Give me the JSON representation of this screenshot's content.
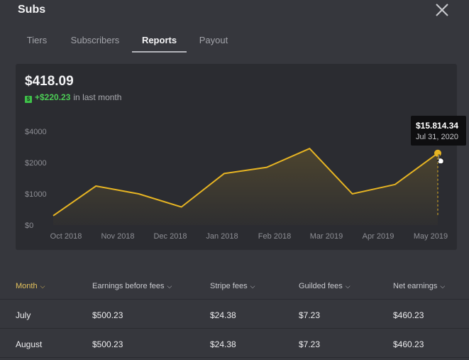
{
  "header": {
    "title": "Subs"
  },
  "tabs": [
    {
      "label": "Tiers"
    },
    {
      "label": "Subscribers"
    },
    {
      "label": "Reports"
    },
    {
      "label": "Payout"
    }
  ],
  "active_tab": "Reports",
  "summary": {
    "total": "$418.09",
    "change": "+$220.23",
    "change_suffix": "in last month"
  },
  "colors": {
    "accent": "#e6b423",
    "positive": "#4ccb55",
    "active_header": "#e4c25d"
  },
  "chart_data": {
    "type": "area",
    "title": "",
    "xlabel": "",
    "ylabel": "",
    "x_ticks": [
      "Oct 2018",
      "Nov 2018",
      "Dec 2018",
      "Jan 2018",
      "Feb 2018",
      "Mar 2019",
      "Apr 2019",
      "May 2019"
    ],
    "y_ticks": [
      "$0",
      "$1000",
      "$2000",
      "$4000"
    ],
    "ylim": [
      0,
      4000
    ],
    "grid": false,
    "series": [
      {
        "values": [
          300,
          1250,
          1000,
          580,
          1650,
          1850,
          2450,
          1000,
          1300,
          2300
        ]
      }
    ],
    "tooltip": {
      "value": "$15.814.34",
      "date": "Jul 31, 2020"
    }
  },
  "table": {
    "columns": [
      "Month",
      "Earnings before fees",
      "Stripe fees",
      "Guilded fees",
      "Net earnings"
    ],
    "rows": [
      [
        "July",
        "$500.23",
        "$24.38",
        "$7.23",
        "$460.23"
      ],
      [
        "August",
        "$500.23",
        "$24.38",
        "$7.23",
        "$460.23"
      ]
    ]
  },
  "icons": {
    "close": "close-icon",
    "sort": "chevron-down-icon",
    "cursor": "hand-pointer-icon"
  }
}
